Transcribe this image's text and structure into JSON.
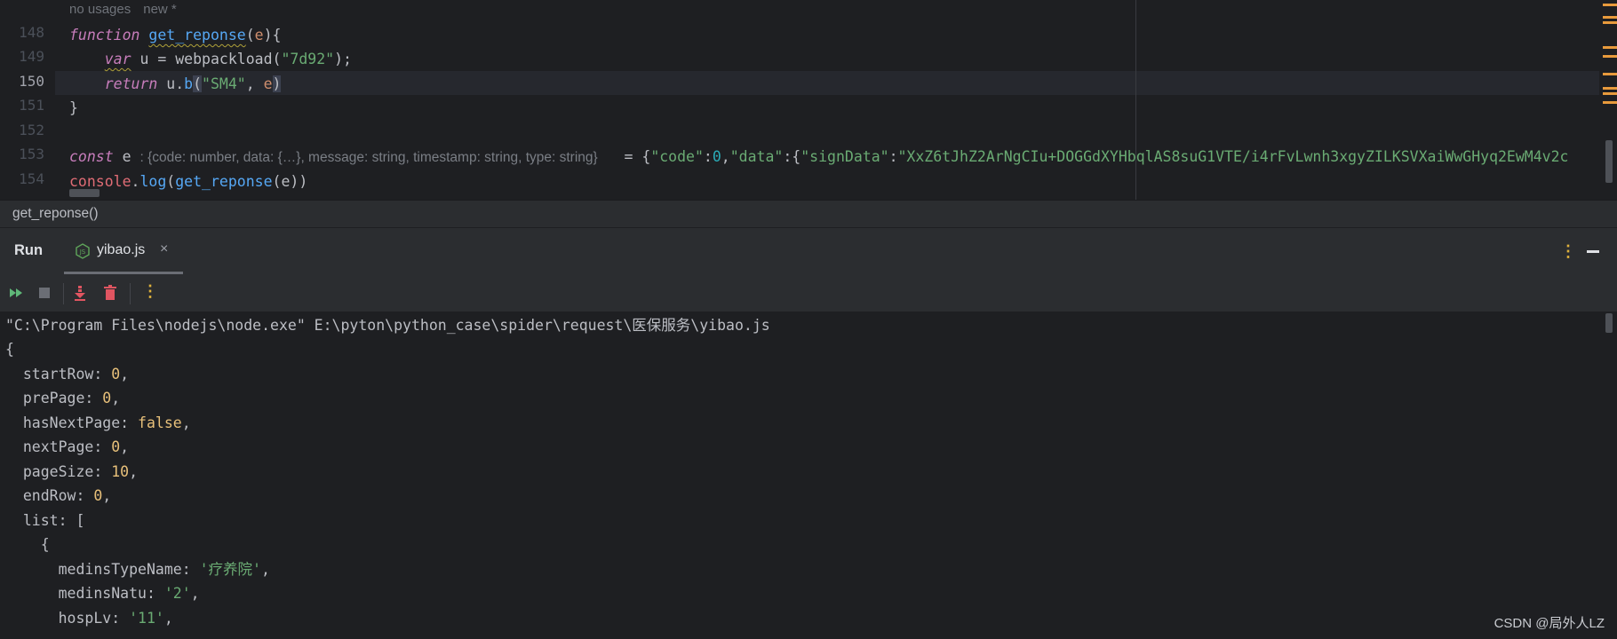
{
  "editor": {
    "usage_hint": "no usages",
    "usage_new": "new *",
    "lines": [
      {
        "num": "148"
      },
      {
        "num": "149"
      },
      {
        "num": "150"
      },
      {
        "num": "151"
      },
      {
        "num": "152"
      },
      {
        "num": "153"
      },
      {
        "num": "154"
      }
    ],
    "l148": {
      "kw": "function",
      "name": "get_reponse",
      "open": "(",
      "param": "e",
      "close": "){"
    },
    "l149": {
      "kw": "var",
      "rest": " u = webpackload(",
      "str": "\"7d92\"",
      "end": ");"
    },
    "l150": {
      "kw": "return",
      "rest": " u.",
      "call": "b",
      "open": "(",
      "str": "\"SM4\"",
      "comma": ", ",
      "param": "e",
      "close": ")"
    },
    "l151": {
      "text": "}"
    },
    "l153": {
      "kw": "const",
      "name": " e ",
      "inlay": ": {code: number, data: {…}, message: string, timestamp: string, type: string}",
      "eq": "= {",
      "k1": "\"code\"",
      "colon1": ":",
      "v1": "0",
      "comma1": ",",
      "k2": "\"data\"",
      "colon2": ":{",
      "k3": "\"signData\"",
      "colon3": ":",
      "v3": "\"XxZ6tJhZ2ArNgCIu+DOGGdXYHbqlAS8suG1VTE/i4rFvLwnh3xgyZILKSVXaiWwGHyq2EwM4v2c"
    },
    "l154": {
      "obj": "console",
      "dot": ".",
      "fn": "log",
      "open": "(",
      "call": "get_reponse",
      "rest": "(e))"
    }
  },
  "breadcrumb": {
    "text": "get_reponse()"
  },
  "run": {
    "title": "Run",
    "tab_label": "yibao.js",
    "tab_close": "×",
    "kebab": "⋮"
  },
  "console": {
    "command": "\"C:\\Program Files\\nodejs\\node.exe\" E:\\pyton\\python_case\\spider\\request\\医保服务\\yibao.js",
    "open_brace": "{",
    "fields": [
      {
        "key": "startRow",
        "value": "0",
        "kind": "num"
      },
      {
        "key": "prePage",
        "value": "0",
        "kind": "num"
      },
      {
        "key": "hasNextPage",
        "value": "false",
        "kind": "bool"
      },
      {
        "key": "nextPage",
        "value": "0",
        "kind": "num"
      },
      {
        "key": "pageSize",
        "value": "10",
        "kind": "num"
      },
      {
        "key": "endRow",
        "value": "0",
        "kind": "num"
      }
    ],
    "list_key": "list",
    "list_open": "[",
    "item_open": "{",
    "item_fields": [
      {
        "key": "medinsTypeName",
        "value": "'疗养院'"
      },
      {
        "key": "medinsNatu",
        "value": "'2'"
      },
      {
        "key": "hospLv",
        "value": "'11'"
      }
    ]
  },
  "watermark": "CSDN @局外人LZ"
}
